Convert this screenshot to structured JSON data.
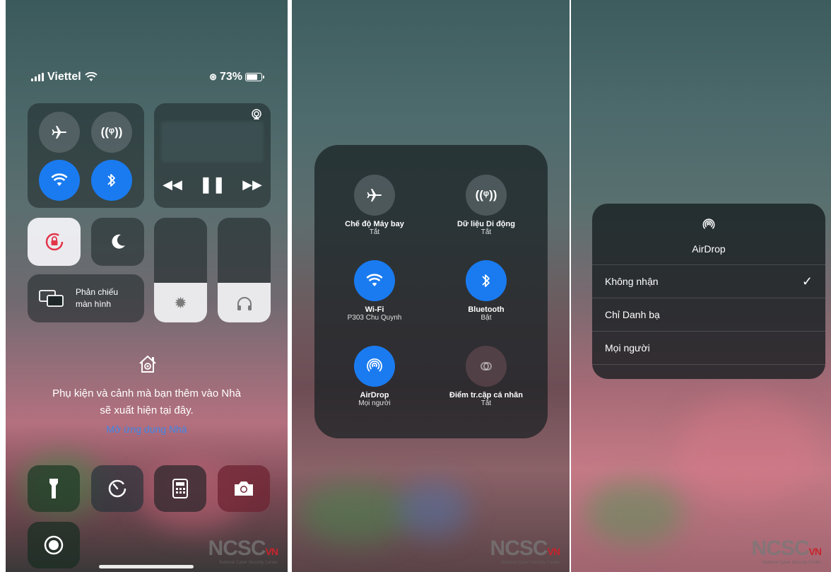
{
  "status_bar": {
    "carrier": "Viettel",
    "battery": "73%",
    "battery_level": 0.73
  },
  "connectivity": {
    "airplane_icon": "airplane-icon",
    "cellular_icon": "cellular-antenna-icon",
    "wifi_icon": "wifi-icon",
    "bluetooth_icon": "bluetooth-icon"
  },
  "media": {
    "airplay_icon": "airplay-icon",
    "prev_icon": "rewind-icon",
    "pause_icon": "pause-icon",
    "next_icon": "forward-icon"
  },
  "tiles": {
    "rotation_lock_icon": "rotation-lock-icon",
    "do_not_disturb_icon": "moon-icon",
    "screen_mirroring_icon": "screen-mirroring-icon",
    "screen_mirroring_label": "Phản chiếu\nmàn hình"
  },
  "sliders": {
    "brightness_level": 0.38,
    "volume_level": 0.38
  },
  "home": {
    "icon": "home-icon",
    "message_line1": "Phụ kiện và cảnh mà bạn thêm vào Nhà",
    "message_line2": "sẽ xuất hiện tại đây.",
    "link": "Mở ứng dụng Nhà"
  },
  "bottom_buttons": [
    {
      "name": "flashlight",
      "icon": "flashlight-icon"
    },
    {
      "name": "timer",
      "icon": "timer-icon"
    },
    {
      "name": "calculator",
      "icon": "calculator-icon"
    },
    {
      "name": "camera",
      "icon": "camera-icon"
    },
    {
      "name": "screen-recording",
      "icon": "record-icon"
    }
  ],
  "expanded_panel": {
    "items": [
      {
        "title": "Chế độ Máy bay",
        "status": "Tắt",
        "icon": "airplane-icon"
      },
      {
        "title": "Dữ liệu Di động",
        "status": "Tắt",
        "icon": "cellular-antenna-icon"
      },
      {
        "title": "Wi-Fi",
        "status": "P303 Chu Quynh",
        "icon": "wifi-icon"
      },
      {
        "title": "Bluetooth",
        "status": "Bật",
        "icon": "bluetooth-icon"
      },
      {
        "title": "AirDrop",
        "status": "Mọi người",
        "icon": "airdrop-icon"
      },
      {
        "title": "Điểm tr.cập cá nhân",
        "status": "Tắt",
        "icon": "hotspot-icon"
      }
    ]
  },
  "airdrop_menu": {
    "icon": "airdrop-icon",
    "title": "AirDrop",
    "options": [
      {
        "label": "Không nhận",
        "selected": true
      },
      {
        "label": "Chỉ Danh bạ",
        "selected": false
      },
      {
        "label": "Mọi người",
        "selected": false
      }
    ]
  },
  "watermark": {
    "text": "NCSC",
    "suffix": "VN",
    "subtitle": "National Cyber Security Center"
  },
  "colors": {
    "accent_blue": "#1a7bf0",
    "link_blue": "#3d86e8",
    "watermark_red": "#c8242c"
  }
}
